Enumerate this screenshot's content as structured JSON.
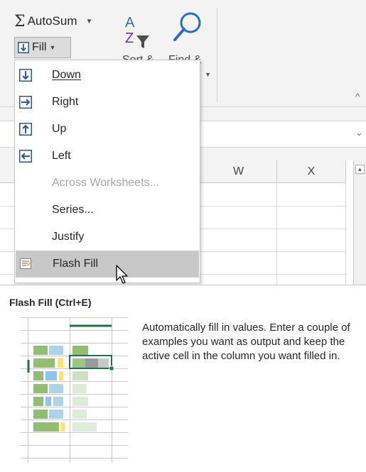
{
  "ribbon": {
    "autosum_label": "AutoSum",
    "fill_label": "Fill",
    "sort_label": "Sort &",
    "find_label": "Find &"
  },
  "grid": {
    "columns": [
      "W",
      "X"
    ]
  },
  "menu": {
    "items": [
      {
        "label": "Down",
        "icon": "fill-down-icon",
        "enabled": true
      },
      {
        "label": "Right",
        "icon": "fill-right-icon",
        "enabled": true
      },
      {
        "label": "Up",
        "icon": "fill-up-icon",
        "enabled": true
      },
      {
        "label": "Left",
        "icon": "fill-left-icon",
        "enabled": true
      },
      {
        "label": "Across Worksheets...",
        "icon": "",
        "enabled": false
      },
      {
        "label": "Series...",
        "icon": "",
        "enabled": true
      },
      {
        "label": "Justify",
        "icon": "",
        "enabled": true
      },
      {
        "label": "Flash Fill",
        "icon": "flash-fill-icon",
        "enabled": true,
        "highlighted": true
      }
    ]
  },
  "tooltip": {
    "title": "Flash Fill (Ctrl+E)",
    "description": "Automatically fill in values. Enter a couple of examples you want as output and keep the active cell in the column you want filled in."
  },
  "colors": {
    "accent_blue": "#2b579a",
    "excel_green": "#217346",
    "highlight_gray": "#c8c8c8"
  }
}
